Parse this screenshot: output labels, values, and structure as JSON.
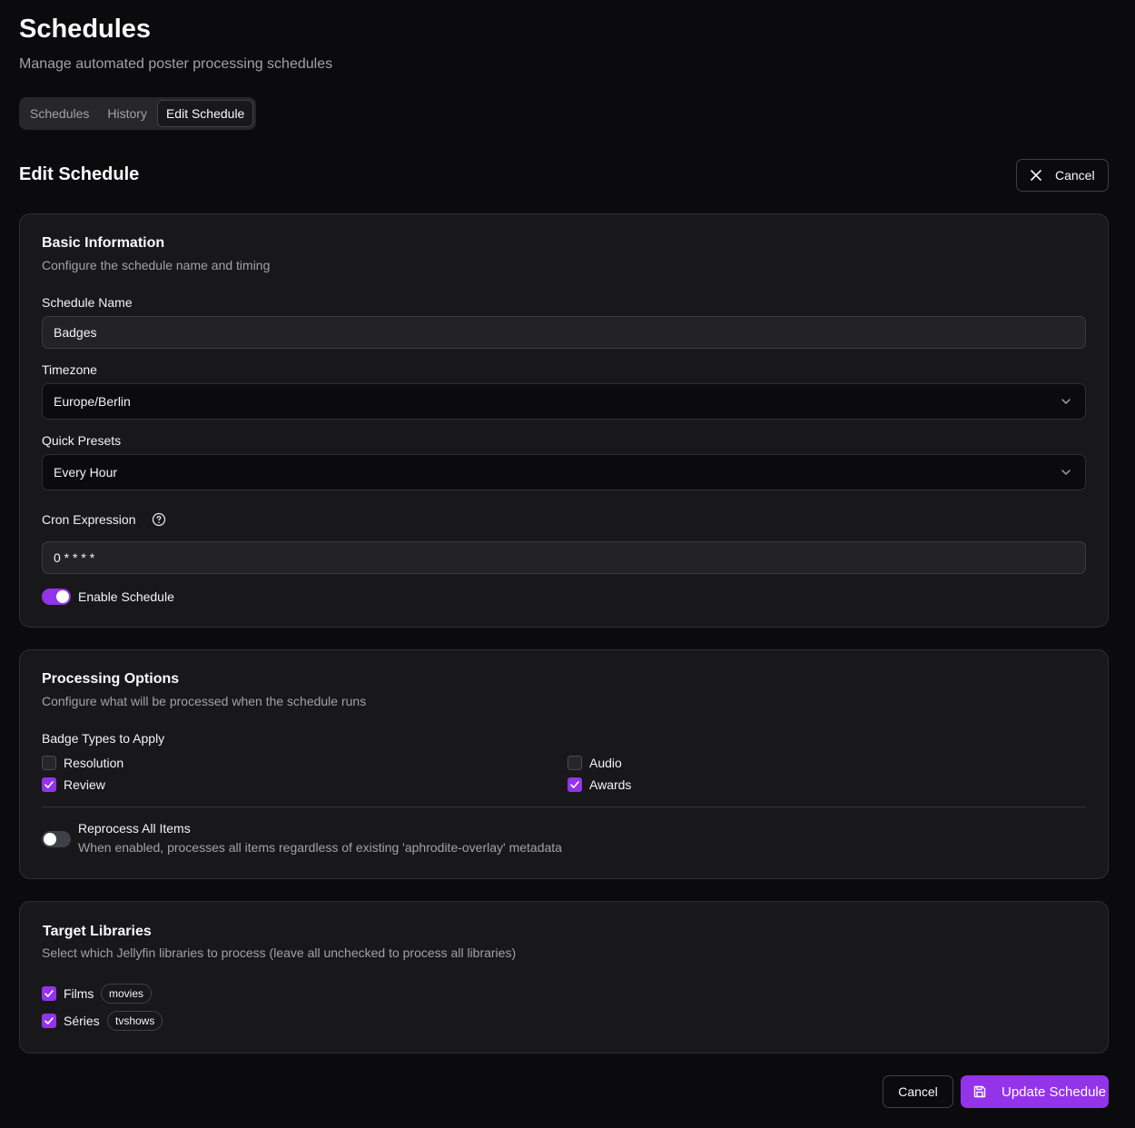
{
  "header": {
    "title": "Schedules",
    "subtitle": "Manage automated poster processing schedules"
  },
  "tabs": [
    {
      "label": "Schedules",
      "active": false
    },
    {
      "label": "History",
      "active": false
    },
    {
      "label": "Edit Schedule",
      "active": true
    }
  ],
  "section": {
    "title": "Edit Schedule",
    "cancel_label": "Cancel"
  },
  "basic": {
    "title": "Basic Information",
    "description": "Configure the schedule name and timing",
    "name_label": "Schedule Name",
    "name_value": "Badges",
    "timezone_label": "Timezone",
    "timezone_value": "Europe/Berlin",
    "presets_label": "Quick Presets",
    "presets_value": "Every Hour",
    "cron_label": "Cron Expression",
    "cron_value": "0 * * * *",
    "enable_label": "Enable Schedule",
    "enabled": true
  },
  "processing": {
    "title": "Processing Options",
    "description": "Configure what will be processed when the schedule runs",
    "badge_types_label": "Badge Types to Apply",
    "badges": [
      {
        "label": "Resolution",
        "checked": false
      },
      {
        "label": "Audio",
        "checked": false
      },
      {
        "label": "Review",
        "checked": true
      },
      {
        "label": "Awards",
        "checked": true
      }
    ],
    "reprocess_label": "Reprocess All Items",
    "reprocess_description": "When enabled, processes all items regardless of existing 'aphrodite-overlay' metadata",
    "reprocess_enabled": false
  },
  "libraries": {
    "title": "Target Libraries",
    "description": "Select which Jellyfin libraries to process (leave all unchecked to process all libraries)",
    "items": [
      {
        "label": "Films",
        "tag": "movies",
        "checked": true
      },
      {
        "label": "Séries",
        "tag": "tvshows",
        "checked": true
      }
    ]
  },
  "footer": {
    "cancel_label": "Cancel",
    "update_label": "Update Schedule"
  },
  "colors": {
    "accent": "#9333ea",
    "background": "#0b0b0d",
    "card": "#18181b"
  }
}
